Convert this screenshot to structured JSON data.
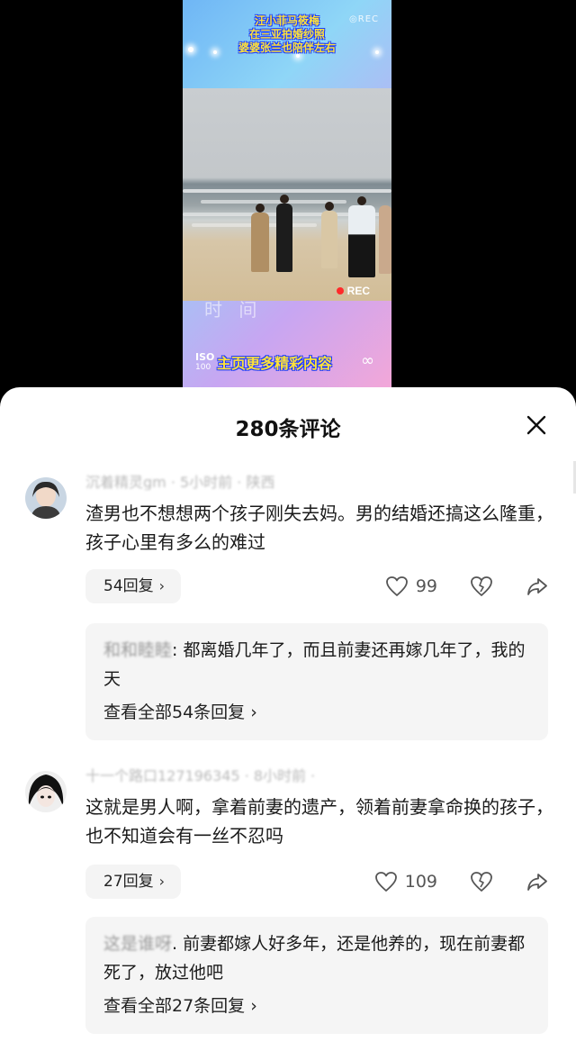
{
  "video": {
    "caption_lines": [
      "汪小菲马筱梅",
      "在三亚拍婚纱照",
      "婆婆张兰也陪伴左右"
    ],
    "rec_top": "◎REC",
    "rec_label": "REC",
    "ghost_text": "时 间",
    "iso_label": "ISO",
    "iso_value": "100",
    "banner": "主页更多精彩内容"
  },
  "comments_sheet": {
    "title": "280条评论",
    "comments": [
      {
        "username": "沉着精灵gm · 5小时前 · 陕西",
        "text": "渣男也不想想两个孩子刚失去妈。男的结婚还搞这么隆重，孩子心里有多么的难过",
        "reply_count_label": "54回复",
        "likes": "99",
        "top_reply_name": "和和睦睦",
        "top_reply_text": ": 都离婚几年了，而且前妻还再嫁几年了，我的天",
        "view_all_label": "查看全部54条回复"
      },
      {
        "username": "十一个路口127196345 · 8小时前 · 广东",
        "text": "这就是男人啊，拿着前妻的遗产，领着前妻拿命换的孩子，也不知道会有一丝不忍吗",
        "reply_count_label": "27回复",
        "likes": "109",
        "top_reply_name": "这是谁呀",
        "top_reply_text": ". 前妻都嫁人好多年，还是他养的，现在前妻都死了，放过他吧",
        "view_all_label": "查看全部27条回复"
      }
    ]
  },
  "colors": {
    "caption_yellow": "#ffe23a",
    "caption_outline": "#1c3cff",
    "rec_red": "#ff2a2a",
    "reply_bg": "#f5f5f5"
  },
  "icons": [
    "close-icon",
    "heart-icon",
    "broken-heart-icon",
    "share-icon",
    "chevron-right-icon"
  ]
}
